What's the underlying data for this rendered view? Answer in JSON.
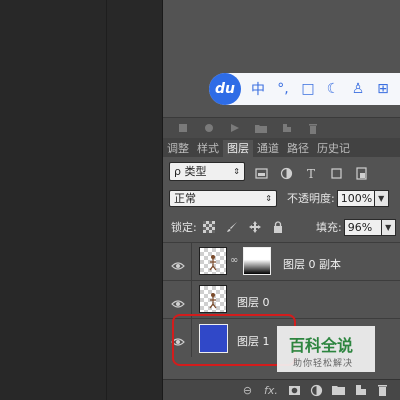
{
  "ime_toolbar": {
    "logo": "du",
    "items": [
      "中",
      "°,",
      "□",
      "☾",
      "♙",
      "⊞"
    ]
  },
  "layers_panel": {
    "tabs": [
      {
        "label": "调整",
        "active": false
      },
      {
        "label": "样式",
        "active": false
      },
      {
        "label": "图层",
        "active": true
      },
      {
        "label": "通道",
        "active": false
      },
      {
        "label": "路径",
        "active": false
      },
      {
        "label": "历史记",
        "active": false
      }
    ],
    "filter_kind": "ρ 类型",
    "blend_mode": "正常",
    "opacity_label": "不透明度:",
    "opacity_value": "100%",
    "lock_label": "锁定:",
    "fill_label": "填充:",
    "fill_value": "96%",
    "layers": [
      {
        "name": "图层 0 副本",
        "has_mask": true,
        "selected": false
      },
      {
        "name": "图层 0",
        "has_mask": false,
        "selected": false
      },
      {
        "name": "图层 1",
        "has_mask": false,
        "selected": true,
        "thumb_color": "#3048c8"
      }
    ],
    "bottom_icons": [
      "link-icon",
      "fx-icon",
      "mask-icon",
      "adjustment-icon",
      "group-icon",
      "new-layer-icon",
      "trash-icon"
    ],
    "fx_label": "fx."
  },
  "watermark": {
    "title": "百科全说",
    "subtitle": "助你轻松解决"
  },
  "colors": {
    "panel_bg": "#535353",
    "selected_layer": "#3048c8",
    "highlight_border": "#d31c1c",
    "ime_accent": "#2e6ce6"
  }
}
